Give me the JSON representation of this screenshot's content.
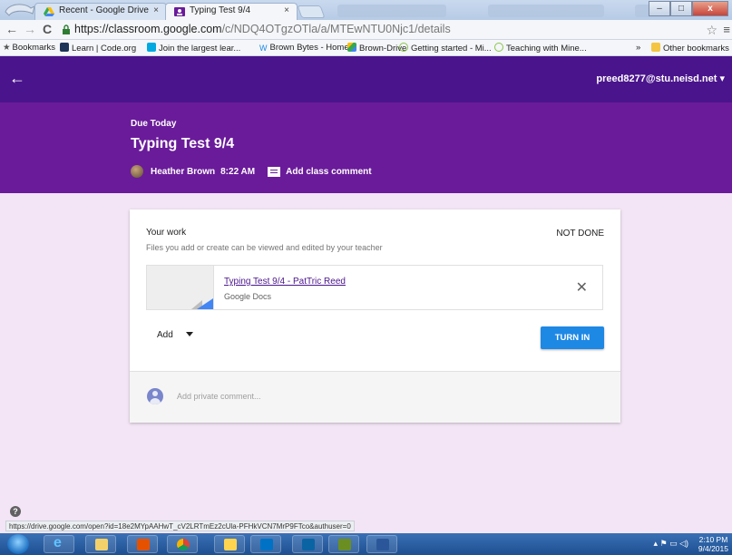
{
  "browser": {
    "tabs": [
      {
        "label": "Recent - Google Drive",
        "active": false
      },
      {
        "label": "Typing Test 9/4",
        "active": true
      }
    ],
    "tab_close_glyph": "×",
    "url_host": "https://classroom.google.com",
    "url_path": "/c/NDQ4OTgzOTla/a/MTEwNTU0Njc1/details",
    "window_controls": {
      "minimize": "–",
      "maximize": "□",
      "close": "x"
    },
    "bookmarks": [
      {
        "label": "Bookmarks",
        "icon": "star-icon"
      },
      {
        "label": "Learn | Code.org",
        "icon": "code-org-icon"
      },
      {
        "label": "Join the largest lear...",
        "icon": "blue-square-icon"
      },
      {
        "label": "Brown Bytes - Home",
        "icon": "wix-icon"
      },
      {
        "label": "Brown-Drive",
        "icon": "drive-icon"
      },
      {
        "label": "Getting started - Mi...",
        "icon": "page-icon"
      },
      {
        "label": "Teaching with Mine...",
        "icon": "page-icon"
      },
      {
        "label": "»",
        "icon": ""
      },
      {
        "label": "Other bookmarks",
        "icon": "folder-icon"
      }
    ]
  },
  "app": {
    "account": "preed8277@stu.neisd.net",
    "due_label": "Due Today",
    "assignment_title": "Typing Test 9/4",
    "teacher_name": "Heather Brown",
    "posted_time": "8:22 AM",
    "add_class_comment": "Add class comment",
    "work": {
      "heading": "Your work",
      "subtext": "Files you add or create can be viewed and edited by your teacher",
      "status": "NOT DONE",
      "attachment": {
        "title": "Typing Test 9/4 - PatTric Reed",
        "type": "Google Docs",
        "remove_glyph": "✕"
      },
      "add_label": "Add",
      "turn_in_label": "TURN IN"
    },
    "private_comment_placeholder": "Add private comment...",
    "help_glyph": "?"
  },
  "status_url": "https://drive.google.com/open?id=18e2MYpAAHwT_cV2LRTmEz2cUla-PFHkVCN7MrP9FTco&authuser=0",
  "taskbar": {
    "items": [
      "ie-icon",
      "explorer-icon",
      "media-icon",
      "chrome-icon",
      "app-grid-icon",
      "lync-icon",
      "outlook-icon",
      "minecraft-icon",
      "word-icon"
    ],
    "tray_glyphs": "▴  ⚑  ▭  ◁)",
    "time": "2:10 PM",
    "date": "9/4/2015"
  },
  "colors": {
    "header": "#4a148c",
    "hero": "#6a1b9a",
    "page_bg": "#f3e5f5",
    "turn_in": "#1e88e5"
  }
}
